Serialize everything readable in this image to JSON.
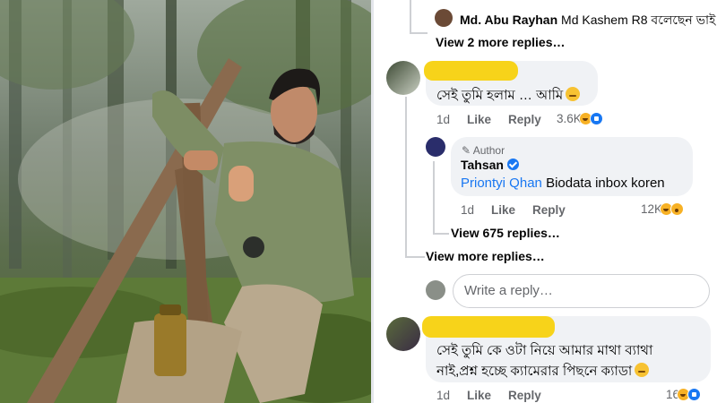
{
  "thread": {
    "reply_top": {
      "author": "Md. Abu Rayhan",
      "text": "Md Kashem R8 বলেছেন ভাই"
    },
    "view_more_replies_top": "View 2 more replies…",
    "comment1": {
      "text": "সেই তুমি হলাম … আমি",
      "emoji": "pleading-face-icon",
      "time": "1d",
      "like": "Like",
      "reply": "Reply",
      "reaction_count": "3.6K",
      "reactions": [
        "haha",
        "like"
      ]
    },
    "author_reply": {
      "badge": "Author",
      "author": "Tahsan",
      "mention": "Priontyi Qhan",
      "text": "Biodata inbox koren",
      "time": "1d",
      "like": "Like",
      "reply": "Reply",
      "reaction_count": "12K",
      "reactions": [
        "haha",
        "wow"
      ]
    },
    "view_675": "View 675 replies…",
    "view_more_replies": "View more replies…",
    "write_reply_placeholder": "Write a reply…",
    "comment2": {
      "line1": "সেই তুমি কে ওটা নিয়ে আমার মাথা ব্যাথা",
      "line2": "নাই,প্রশ্ন হচ্ছে ক্যামেরার পিছনে ক্যাডা",
      "emoji": "unamused-face-icon",
      "time": "1d",
      "like": "Like",
      "reply": "Reply",
      "reaction_count": "16",
      "reactions": [
        "haha",
        "like"
      ]
    }
  },
  "colors": {
    "bubble": "#f0f2f5",
    "link_blue": "#1877f2",
    "redaction_yellow": "#f7d31a",
    "meta_gray": "#65676b"
  }
}
